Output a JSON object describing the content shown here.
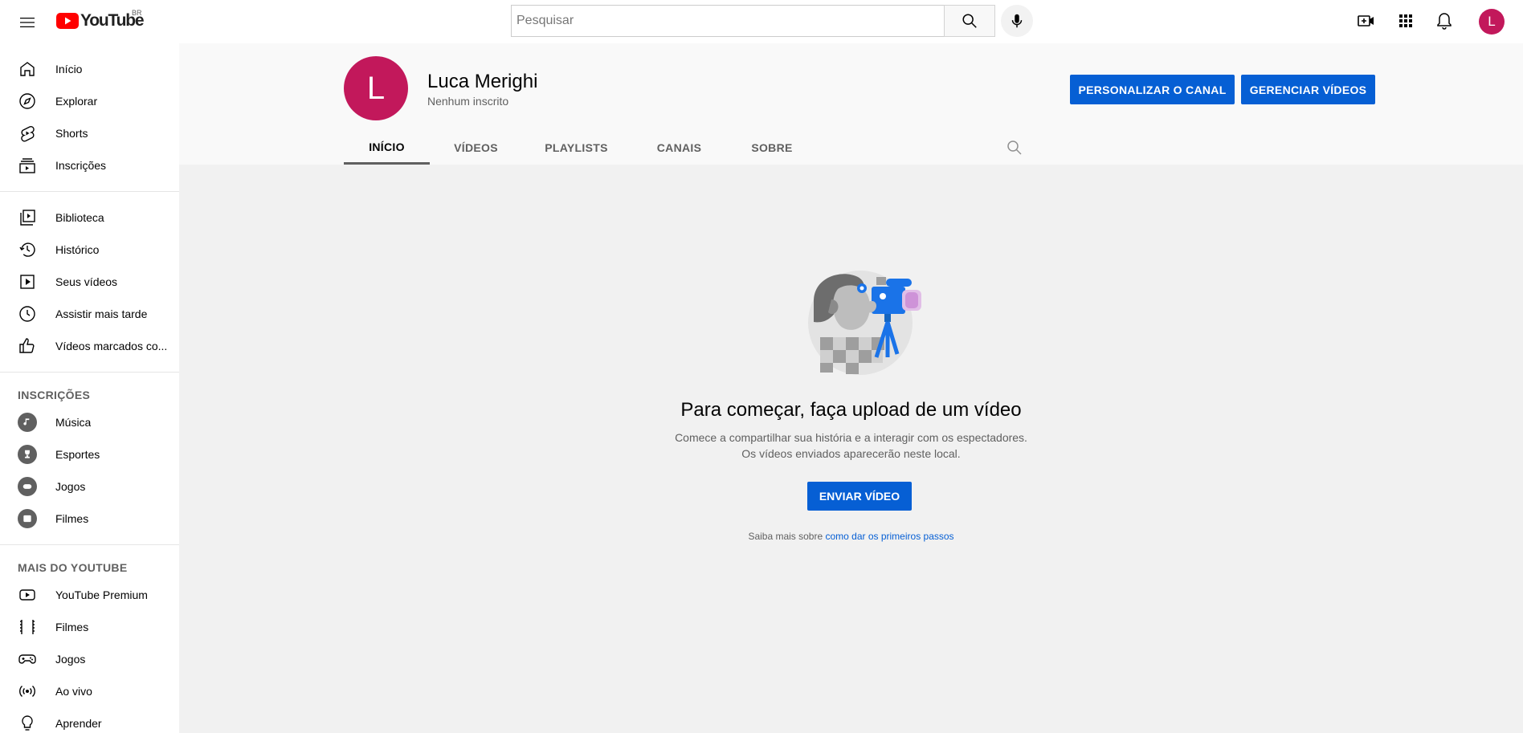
{
  "topbar": {
    "logo_text": "YouTube",
    "country_code": "BR",
    "search_placeholder": "Pesquisar",
    "avatar_letter": "L",
    "icons": [
      "menu-icon",
      "search-icon",
      "mic-icon",
      "create-video-icon",
      "apps-icon",
      "notifications-icon"
    ]
  },
  "sidebar": {
    "main": [
      {
        "label": "Início",
        "icon": "home-icon"
      },
      {
        "label": "Explorar",
        "icon": "compass-icon"
      },
      {
        "label": "Shorts",
        "icon": "shorts-icon"
      },
      {
        "label": "Inscrições",
        "icon": "subscriptions-icon"
      }
    ],
    "library": [
      {
        "label": "Biblioteca",
        "icon": "library-icon"
      },
      {
        "label": "Histórico",
        "icon": "history-icon"
      },
      {
        "label": "Seus vídeos",
        "icon": "your-videos-icon"
      },
      {
        "label": "Assistir mais tarde",
        "icon": "watch-later-icon"
      },
      {
        "label": "Vídeos marcados co...",
        "icon": "thumb-up-icon"
      }
    ],
    "subscriptions_heading": "INSCRIÇÕES",
    "subscriptions": [
      {
        "label": "Música",
        "icon": "music-icon"
      },
      {
        "label": "Esportes",
        "icon": "trophy-icon"
      },
      {
        "label": "Jogos",
        "icon": "gamepad-icon"
      },
      {
        "label": "Filmes",
        "icon": "film-icon"
      }
    ],
    "more_heading": "MAIS DO YOUTUBE",
    "more": [
      {
        "label": "YouTube Premium",
        "icon": "youtube-premium-icon"
      },
      {
        "label": "Filmes",
        "icon": "film-strip-icon"
      },
      {
        "label": "Jogos",
        "icon": "gaming-icon"
      },
      {
        "label": "Ao vivo",
        "icon": "live-icon"
      },
      {
        "label": "Aprender",
        "icon": "lightbulb-icon"
      }
    ]
  },
  "channel": {
    "avatar_letter": "L",
    "name": "Luca Merighi",
    "subscribers": "Nenhum inscrito",
    "customize_button": "PERSONALIZAR O CANAL",
    "manage_button": "GERENCIAR VÍDEOS",
    "tabs": [
      "INÍCIO",
      "VÍDEOS",
      "PLAYLISTS",
      "CANAIS",
      "SOBRE"
    ],
    "active_tab": "INÍCIO"
  },
  "empty_state": {
    "title": "Para começar, faça upload de um vídeo",
    "description": "Comece a compartilhar sua história e a interagir com os espectadores. Os vídeos enviados aparecerão neste local.",
    "upload_button": "ENVIAR VÍDEO",
    "learn_prefix": "Saiba mais sobre ",
    "learn_link": "como dar os primeiros passos"
  },
  "colors": {
    "brand_red": "#ff0000",
    "accent_blue": "#065fd4",
    "avatar": "#c2185b"
  }
}
